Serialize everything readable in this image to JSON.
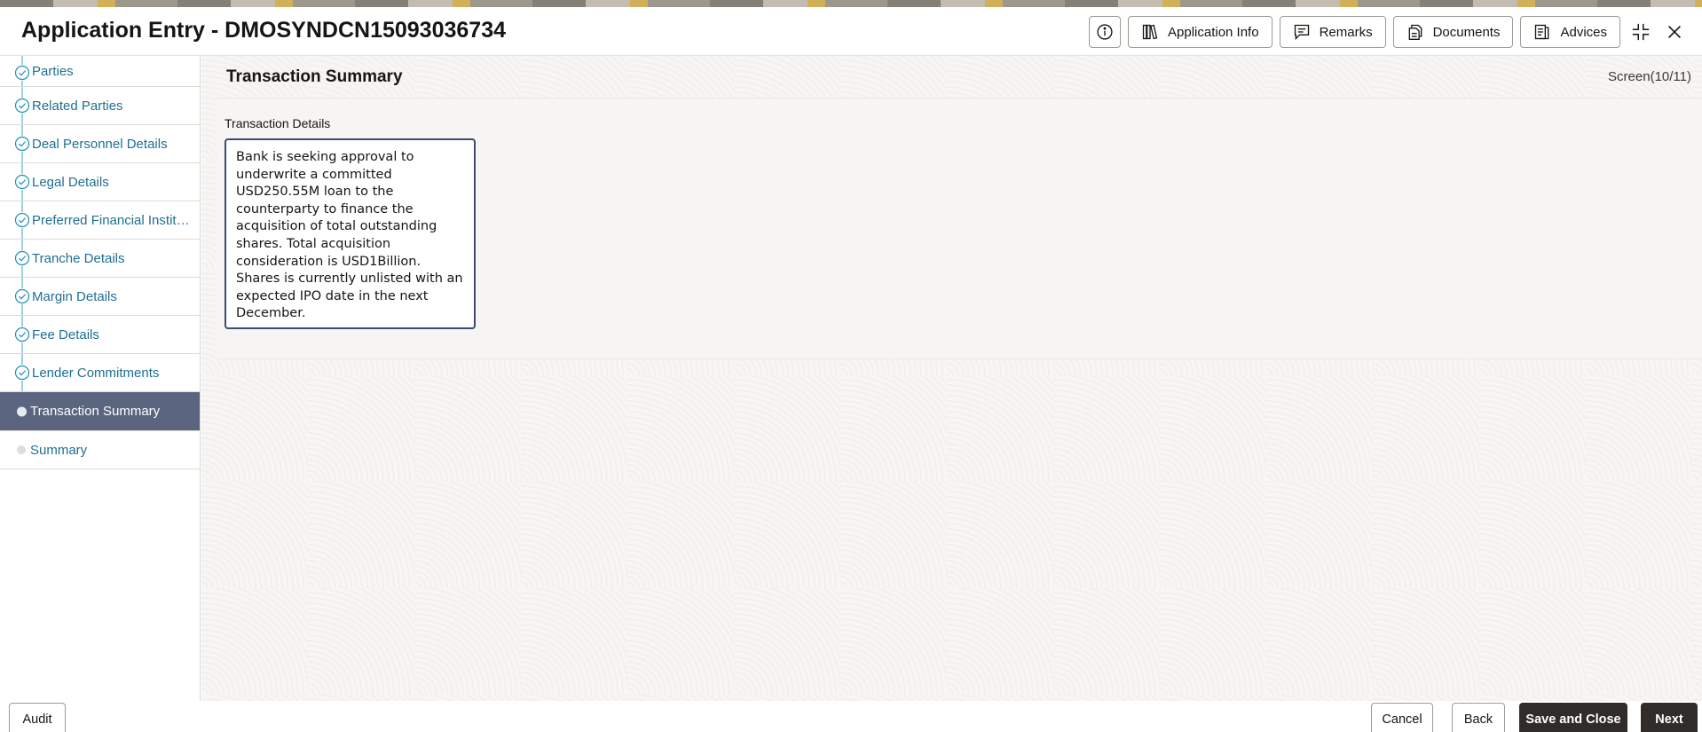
{
  "header": {
    "title": "Application Entry - DMOSYNDCN15093036734",
    "buttons": {
      "application_info": "Application Info",
      "remarks": "Remarks",
      "documents": "Documents",
      "advices": "Advices"
    }
  },
  "sidebar": {
    "items": [
      {
        "label": "Parties",
        "state": "completed"
      },
      {
        "label": "Related Parties",
        "state": "completed"
      },
      {
        "label": "Deal Personnel Details",
        "state": "completed"
      },
      {
        "label": "Legal Details",
        "state": "completed"
      },
      {
        "label": "Preferred Financial Institutions",
        "state": "completed"
      },
      {
        "label": "Tranche Details",
        "state": "completed"
      },
      {
        "label": "Margin Details",
        "state": "completed"
      },
      {
        "label": "Fee Details",
        "state": "completed"
      },
      {
        "label": "Lender Commitments",
        "state": "completed"
      },
      {
        "label": "Transaction Summary",
        "state": "active"
      },
      {
        "label": "Summary",
        "state": "pending"
      }
    ]
  },
  "main": {
    "title": "Transaction Summary",
    "screen_count": "Screen(10/11)",
    "transaction_details": {
      "label": "Transaction Details",
      "value": "Bank is seeking approval to underwrite a committed USD250.55M loan to the counterparty to finance the acquisition of total outstanding shares. Total acquisition consideration is USD1Billion. Shares is currently unlisted with an expected IPO date in the next December."
    }
  },
  "footer": {
    "audit": "Audit",
    "cancel": "Cancel",
    "back": "Back",
    "save_and_close": "Save and Close",
    "next": "Next"
  }
}
